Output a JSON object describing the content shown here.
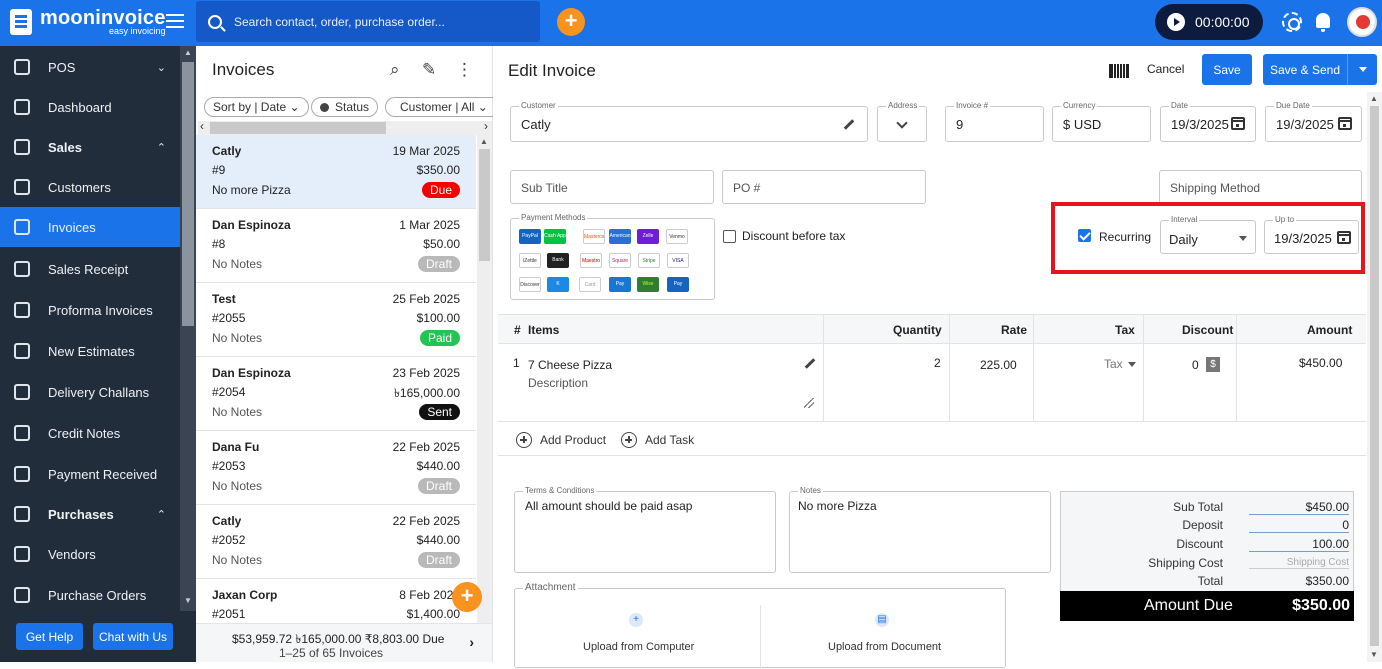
{
  "header": {
    "brand": "mooninvoice",
    "tagline": "easy invoicing",
    "search_placeholder": "Search contact, order, purchase order...",
    "add_symbol": "+",
    "timer": "00:00:00",
    "accent": "#1a73e8"
  },
  "sidebar": {
    "items": [
      {
        "label": "POS",
        "icon": "pos-icon",
        "caret": "⌄"
      },
      {
        "label": "Dashboard",
        "icon": "home-icon"
      },
      {
        "label": "Sales",
        "icon": "sales-icon",
        "caret": "⌃"
      },
      {
        "label": "Customers",
        "icon": "customers-icon"
      },
      {
        "label": "Invoices",
        "icon": "invoice-icon"
      },
      {
        "label": "Sales Receipt",
        "icon": "receipt-icon"
      },
      {
        "label": "Proforma Invoices",
        "icon": "proforma-icon"
      },
      {
        "label": "New Estimates",
        "icon": "estimate-icon"
      },
      {
        "label": "Delivery Challans",
        "icon": "delivery-icon"
      },
      {
        "label": "Credit Notes",
        "icon": "credit-note-icon"
      },
      {
        "label": "Payment Received",
        "icon": "payment-icon"
      },
      {
        "label": "Purchases",
        "icon": "purchases-icon",
        "caret": "⌃"
      },
      {
        "label": "Vendors",
        "icon": "vendors-icon"
      },
      {
        "label": "Purchase Orders",
        "icon": "cart-icon"
      }
    ],
    "get_help": "Get Help",
    "chat": "Chat with Us"
  },
  "list": {
    "title": "Invoices",
    "filters": {
      "sort": "Sort by | Date ⌄",
      "status": "Status",
      "customer": "Customer | All ⌄"
    },
    "rows": [
      {
        "customer": "Catly",
        "date": "19 Mar 2025",
        "number": "#9",
        "amount": "$350.00",
        "note": "No more Pizza",
        "status": "Due"
      },
      {
        "customer": "Dan Espinoza",
        "date": "1 Mar 2025",
        "number": "#8",
        "amount": "$50.00",
        "note": "No Notes",
        "status": "Draft"
      },
      {
        "customer": "Test",
        "date": "25 Feb 2025",
        "number": "#2055",
        "amount": "$100.00",
        "note": "No Notes",
        "status": "Paid"
      },
      {
        "customer": "Dan Espinoza",
        "date": "23 Feb 2025",
        "number": "#2054",
        "amount": "৳165,000.00",
        "note": "No Notes",
        "status": "Sent"
      },
      {
        "customer": "Dana Fu",
        "date": "22 Feb 2025",
        "number": "#2053",
        "amount": "$440.00",
        "note": "No Notes",
        "status": "Draft"
      },
      {
        "customer": "Catly",
        "date": "22 Feb 2025",
        "number": "#2052",
        "amount": "$440.00",
        "note": "No Notes",
        "status": "Draft"
      },
      {
        "customer": "Jaxan Corp",
        "date": "8 Feb 2025",
        "number": "#2051",
        "amount": "$1,400.00",
        "note": "",
        "status": ""
      }
    ],
    "footer_totals": "$53,959.72 ৳165,000.00 ₹8,803.00 Due",
    "footer_count": "1–25 of 65 Invoices",
    "fab": "+"
  },
  "editor": {
    "title": "Edit Invoice",
    "cancel": "Cancel",
    "save": "Save",
    "save_send": "Save & Send",
    "customer_legend": "Customer",
    "customer": "Catly",
    "address_legend": "Address",
    "invoice_legend": "Invoice #",
    "invoice_no": "9",
    "currency_legend": "Currency",
    "currency": "$ USD",
    "date_legend": "Date",
    "date": "19/3/2025",
    "due_legend": "Due Date",
    "due_date": "19/3/2025",
    "subtitle_ph": "Sub Title",
    "po_ph": "PO #",
    "shipping_ph": "Shipping Method",
    "payment_methods_legend": "Payment Methods",
    "payment_methods": [
      "PayPal",
      "Cash App",
      "Mastercard",
      "American Express",
      "Zelle",
      "Venmo",
      "iZettle",
      "Bank",
      "Maestro",
      "Square",
      "Stripe",
      "VISA",
      "Discover",
      "K",
      "Card",
      "Pay",
      "Wise",
      "Pay"
    ],
    "discount_before_tax": "Discount before tax",
    "recurring": "Recurring",
    "interval_legend": "Interval",
    "interval": "Daily",
    "upto_legend": "Up to",
    "upto": "19/3/2025",
    "highlight_color": "#e8141c",
    "columns": {
      "hash": "#",
      "items": "Items",
      "quantity": "Quantity",
      "rate": "Rate",
      "tax": "Tax",
      "discount": "Discount",
      "amount": "Amount"
    },
    "item": {
      "index": "1",
      "name": "7 Cheese Pizza",
      "description": "Description",
      "quantity": "2",
      "rate": "225.00",
      "tax": "Tax",
      "discount": "0",
      "discount_unit": "$",
      "amount": "$450.00"
    },
    "add_product": "Add Product",
    "add_task": "Add Task",
    "terms_legend": "Terms & Conditions",
    "terms": "All amount should be paid asap",
    "notes_legend": "Notes",
    "notes": "No more Pizza",
    "attachment_legend": "Attachment",
    "upload_computer": "Upload from Computer",
    "upload_document": "Upload from Document",
    "totals": {
      "sub_total_label": "Sub Total",
      "sub_total": "$450.00",
      "deposit_label": "Deposit",
      "deposit": "0",
      "discount_label": "Discount",
      "discount": "100.00",
      "shipping_label": "Shipping Cost",
      "shipping": "Shipping Cost",
      "total_label": "Total",
      "total": "$350.00",
      "amount_due_label": "Amount Due",
      "amount_due": "$350.00"
    }
  }
}
